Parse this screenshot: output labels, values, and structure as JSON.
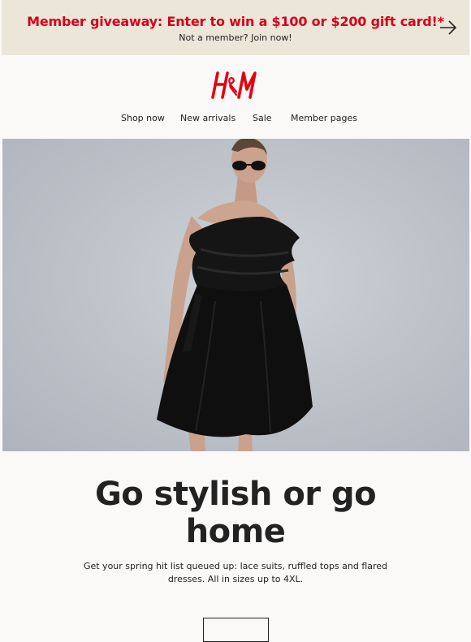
{
  "promo": {
    "title": "Member giveaway: Enter to win a $100 or $200 gift card!*",
    "subtitle": "Not a member? Join now!",
    "arrow_icon": "arrow-right-icon",
    "title_color": "#d5001c",
    "background": "#ece6d8"
  },
  "logo": {
    "text": "H&M",
    "color": "#e50010"
  },
  "nav": {
    "items": [
      {
        "label": "Shop now"
      },
      {
        "label": "New arrivals"
      },
      {
        "label": "Sale"
      },
      {
        "label": "Member pages"
      }
    ]
  },
  "hero": {
    "image_icon": "model-photo",
    "background": "#c2c7ce"
  },
  "main": {
    "headline": "Go stylish or go home",
    "body": "Get your spring hit list queued up: lace suits, ruffled tops and flared dresses. All in sizes up to 4XL."
  }
}
